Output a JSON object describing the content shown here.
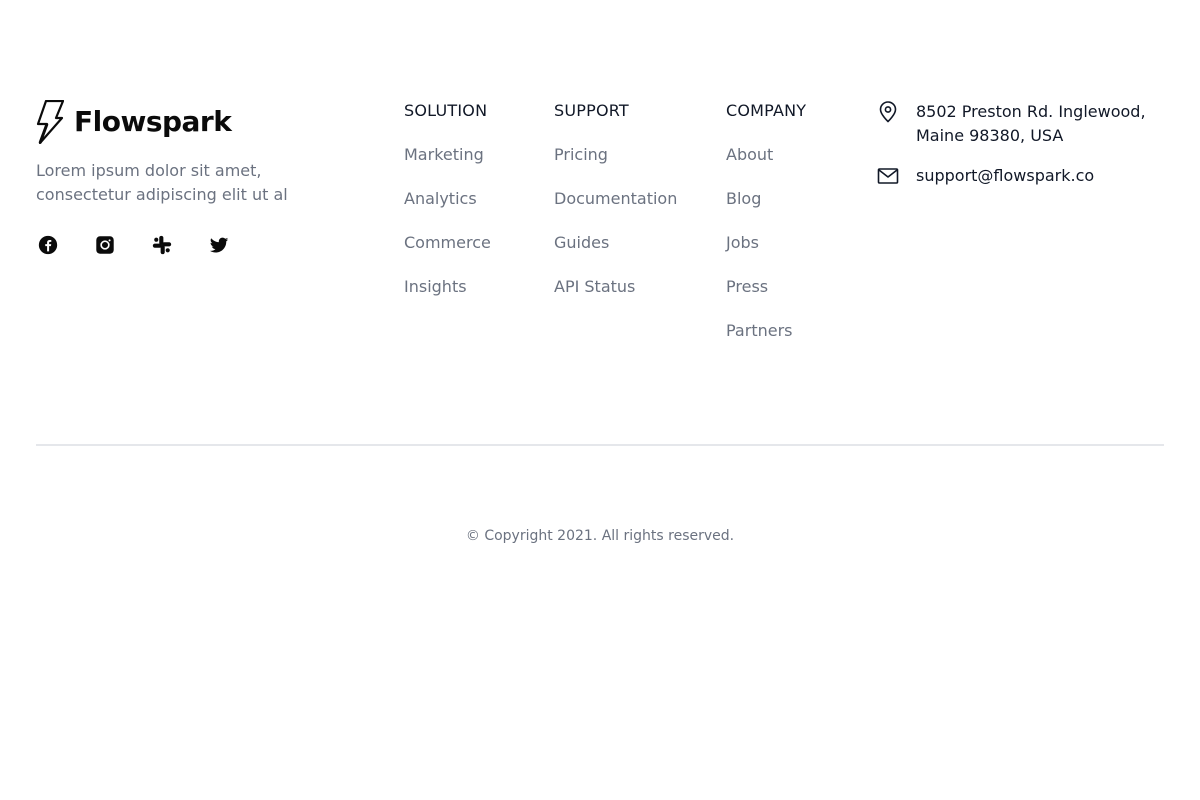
{
  "brand": {
    "name": "Flowspark",
    "tagline": "Lorem ipsum dolor sit amet, consectetur adipiscing elit ut al"
  },
  "socials": [
    {
      "icon": "facebook-icon"
    },
    {
      "icon": "instagram-icon"
    },
    {
      "icon": "slack-icon"
    },
    {
      "icon": "twitter-icon"
    }
  ],
  "columns": {
    "solution": {
      "title": "SOLUTION",
      "items": [
        "Marketing",
        "Analytics",
        "Commerce",
        "Insights"
      ]
    },
    "support": {
      "title": "SUPPORT",
      "items": [
        "Pricing",
        "Documentation",
        "Guides",
        "API Status"
      ]
    },
    "company": {
      "title": "COMPANY",
      "items": [
        "About",
        "Blog",
        "Jobs",
        "Press",
        "Partners"
      ]
    }
  },
  "contact": {
    "address_line1": "8502 Preston Rd. Inglewood,",
    "address_line2": "Maine 98380, USA",
    "email": "support@flowspark.co"
  },
  "copyright": "© Copyright 2021. All rights reserved.",
  "colors": {
    "text_primary": "#111827",
    "text_muted": "#6b7280",
    "divider": "#e5e7eb",
    "logo": "#0b0b0b"
  }
}
